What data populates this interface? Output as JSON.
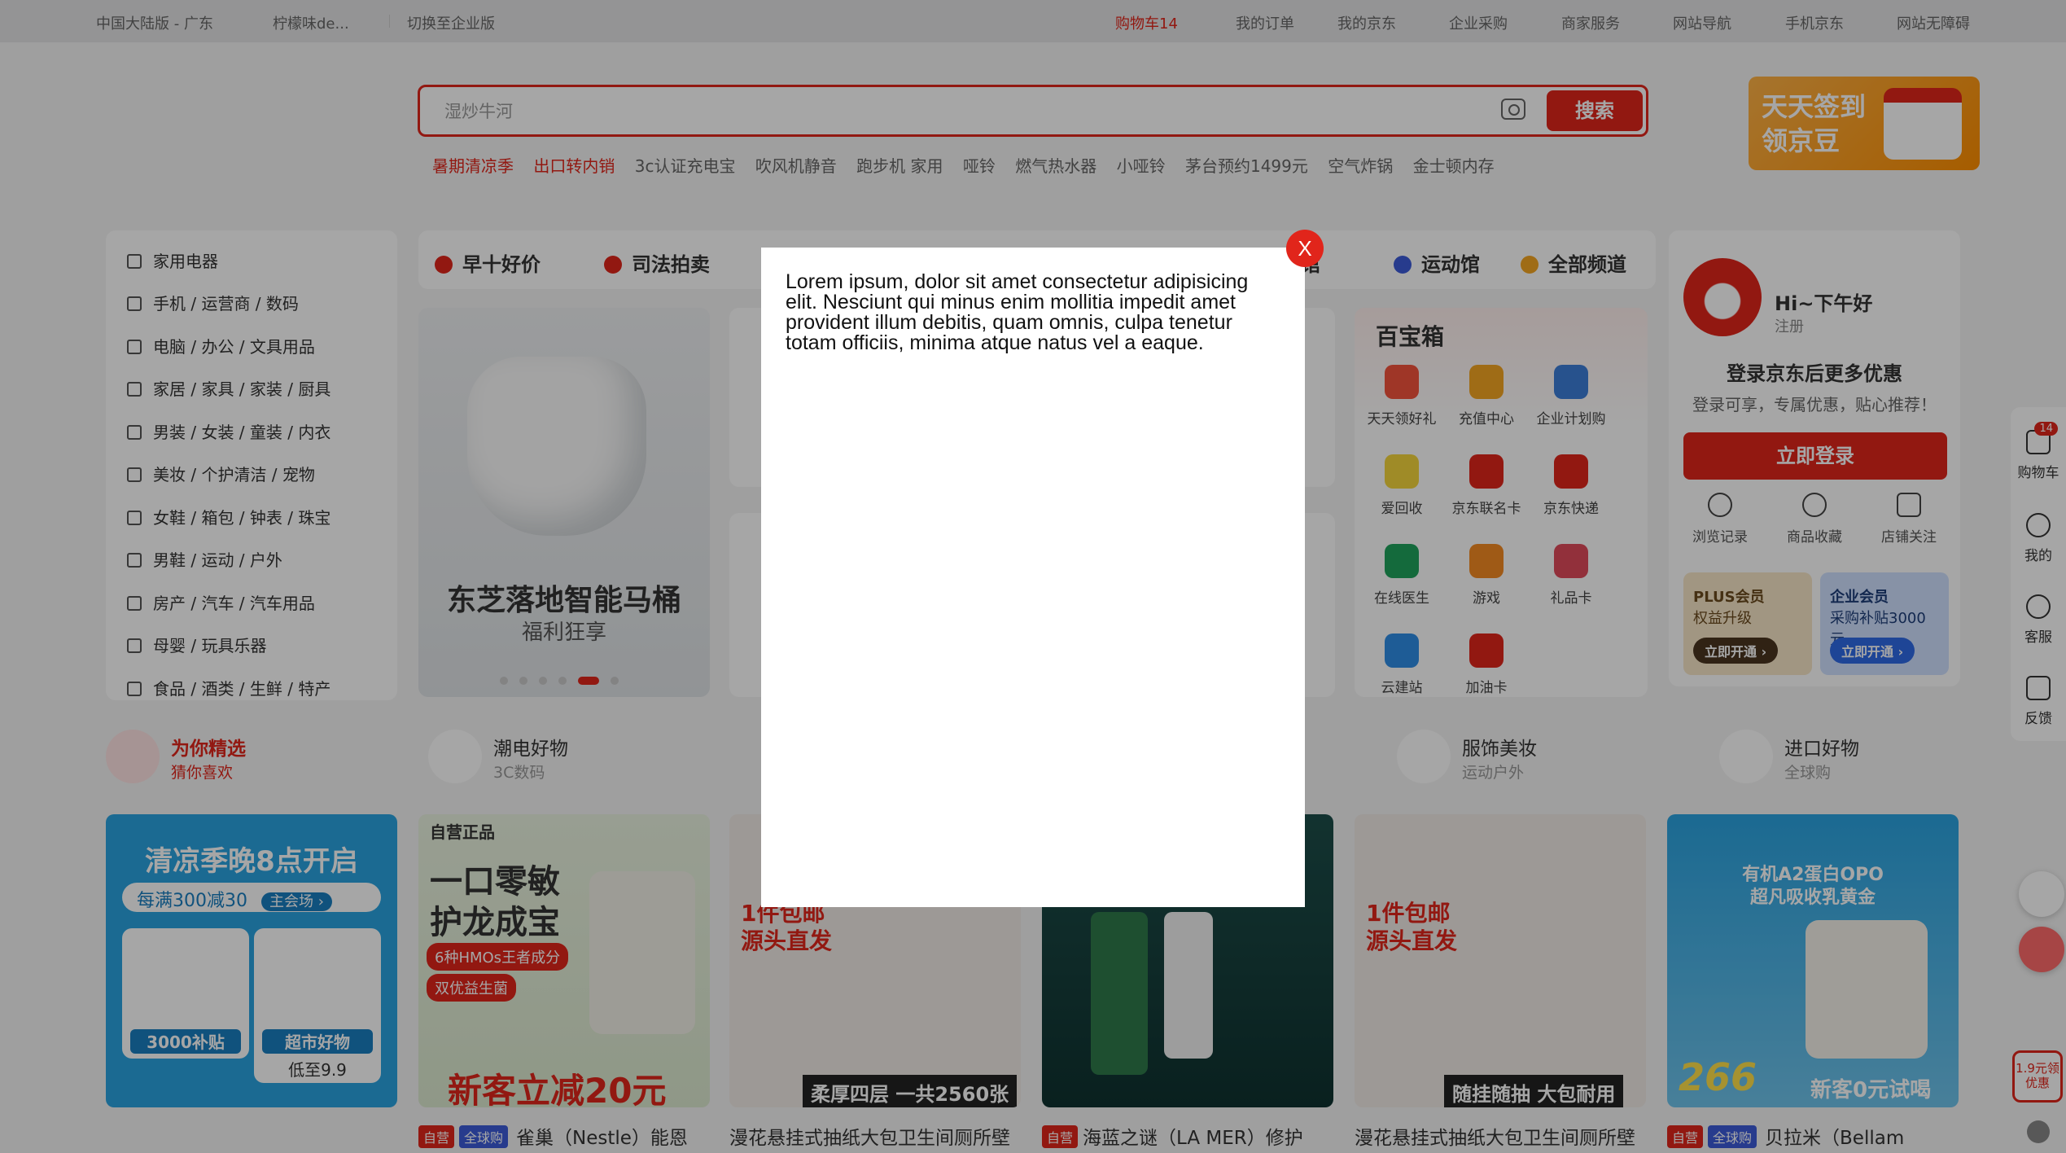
{
  "topbar": {
    "region": "中国大陆版 - 广东",
    "user": "柠檬味de...",
    "switch": "切换至企业版",
    "cart": "购物车14",
    "orders": "我的订单",
    "myjd": "我的京东",
    "enterprise": "企业采购",
    "merchant": "商家服务",
    "sitenav": "网站导航",
    "mobile": "手机京东",
    "accessible": "网站无障碍"
  },
  "search": {
    "placeholder": "湿炒牛河",
    "button": "搜索",
    "hotwords": [
      "暑期清凉季",
      "出口转内销",
      "3c认证充电宝",
      "吹风机静音",
      "跑步机 家用",
      "哑铃",
      "燃气热水器",
      "小哑铃",
      "茅台预约1499元",
      "空气炸锅",
      "金士顿内存"
    ]
  },
  "signin": {
    "line1": "天天签到",
    "line2": "领京豆"
  },
  "categories": [
    "家用电器",
    "手机 / 运营商 / 数码",
    "电脑 / 办公 / 文具用品",
    "家居 / 家具 / 家装 / 厨具",
    "男装 / 女装 / 童装 / 内衣",
    "美妆 / 个护清洁 / 宠物",
    "女鞋 / 箱包 / 钟表 / 珠宝",
    "男鞋 / 运动 / 户外",
    "房产 / 汽车 / 汽车用品",
    "母婴 / 玩具乐器",
    "食品 / 酒类 / 生鲜 / 特产"
  ],
  "navtabs": {
    "t1": "早十好价",
    "t2": "司法拍卖",
    "t3": "馆",
    "t4": "运动馆",
    "t5": "全部频道"
  },
  "banner": {
    "title": "东芝落地智能马桶",
    "sub": "福利狂享"
  },
  "baobox": {
    "title": "百宝箱",
    "items": [
      "天天领好礼",
      "充值中心",
      "企业计划购",
      "爱回收",
      "京东联名卡",
      "京东快递",
      "在线医生",
      "游戏",
      "礼品卡",
      "云建站",
      "加油卡"
    ]
  },
  "user": {
    "hello": "Hi~下午好",
    "register": "注册",
    "login_more": "登录京东后更多优惠",
    "login_sub": "登录可享，专属优惠，贴心推荐！",
    "login_btn": "立即登录",
    "links": [
      "浏览记录",
      "商品收藏",
      "店铺关注"
    ],
    "plus_title": "PLUS会员",
    "plus_sub": "权益升级",
    "plus_btn": "立即开通 ›",
    "ent_title": "企业会员",
    "ent_sub": "采购补贴3000元",
    "ent_btn": "立即开通 ›"
  },
  "rec": {
    "r1a": "为你精选",
    "r1b": "猜你喜欢",
    "r2a": "潮电好物",
    "r2b": "3C数码",
    "r3a": "服饰美妆",
    "r3b": "运动户外",
    "r4a": "进口好物",
    "r4b": "全球购"
  },
  "cards": {
    "c1a": "清凉季晚8点开启",
    "c1b": "每满300减30",
    "c1c": "主会场 ›",
    "c1d": "3000补贴",
    "c1e": "超市好物",
    "c1f": "低至9.9",
    "c2a": "自营正品",
    "c2b": "一口零敏",
    "c2c": "护龙成宝",
    "c2d": "6种HMOs王者成分",
    "c2e": "双优益生菌",
    "c2f": "新客立减20元",
    "c3a": "1件包邮",
    "c3b": "源头直发",
    "c3c": "柔厚四层 一共2560张",
    "c5a": "1件包邮",
    "c5b": "源头直发",
    "c5c": "随挂随抽 大包耐用",
    "c6a": "有机A2蛋白OPO",
    "c6b": "超凡吸收乳黄金",
    "c6c": "266",
    "c6d": "新客0元试喝"
  },
  "captions": {
    "tag_self": "自营",
    "tag_global": "全球购",
    "p1": "雀巢（Nestle）能恩",
    "p2": "漫花悬挂式抽纸大包卫生间厕所壁",
    "p3": "海蓝之谜（LA MER）修护",
    "p4": "漫花悬挂式抽纸大包卫生间厕所壁",
    "p5": "贝拉米（Bellam"
  },
  "rightbar": {
    "cart": "购物车",
    "cart_badge": "14",
    "mine": "我的",
    "service": "客服",
    "feedback": "反馈",
    "promo": "1.9元领优惠"
  },
  "modal": {
    "text": "Lorem ipsum, dolor sit amet consectetur adipisicing elit. Nesciunt qui minus enim mollitia impedit amet provident illum debitis, quam omnis, culpa tenetur totam officiis, minima atque natus vel a eaque.",
    "close": "X"
  }
}
